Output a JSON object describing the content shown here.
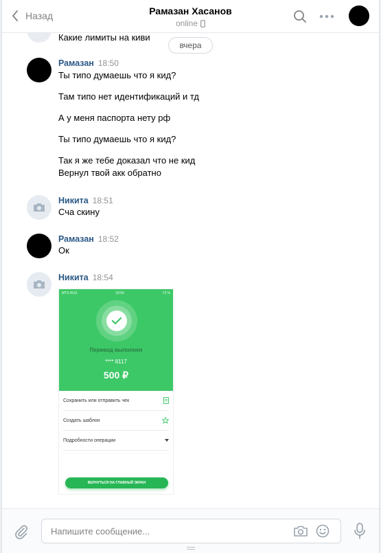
{
  "header": {
    "back_label": "Назад",
    "title": "Рамазан Хасанов",
    "status": "online"
  },
  "feed": {
    "cut_text": "Какие лимиты на киви",
    "date_divider": "вчера",
    "messages": [
      {
        "author": "Рамазан",
        "time": "18:50",
        "lines": [
          "Ты типо думаешь что я кид?",
          "Там типо нет идентификаций и тд",
          "А у меня паспорта нету рф",
          "Ты типо думаешь что я кид?",
          "Так я же тебе доказал что не кид",
          "Вернул твой акк обратно"
        ]
      },
      {
        "author": "Никита",
        "time": "18:51",
        "lines": [
          "Сча скину"
        ]
      },
      {
        "author": "Рамазан",
        "time": "18:52",
        "lines": [
          "Ок"
        ]
      },
      {
        "author": "Никита",
        "time": "18:54",
        "lines": []
      }
    ],
    "attachment": {
      "carrier": "MTS RUS",
      "clock": "18:54",
      "battery": "73 %",
      "status": "Перевод выполнен",
      "card": "**** 8117",
      "amount": "500 ₽",
      "rows": [
        "Сохранить или отправить чек",
        "Создать шаблон",
        "Подробности операции"
      ],
      "button": "ВЕРНУТЬСЯ НА ГЛАВНЫЙ ЭКРАН",
      "accent": "#3dc867"
    }
  },
  "composer": {
    "placeholder": "Напишите сообщение..."
  },
  "colors": {
    "author": "#2a5885",
    "meta": "#939393"
  }
}
